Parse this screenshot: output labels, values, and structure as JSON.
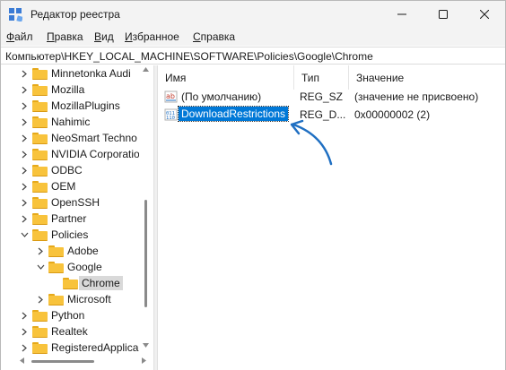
{
  "window": {
    "title": "Редактор реестра"
  },
  "menu": {
    "items": [
      {
        "label": "Файл",
        "accel": "Ф",
        "rest": "айл"
      },
      {
        "label": "Правка",
        "accel": "П",
        "rest": "равка"
      },
      {
        "label": "Вид",
        "accel": "В",
        "rest": "ид"
      },
      {
        "label": "Избранное",
        "accel": "И",
        "rest": "збранное"
      },
      {
        "label": "Справка",
        "accel": "С",
        "rest": "правка"
      }
    ]
  },
  "address": {
    "path": "Компьютер\\HKEY_LOCAL_MACHINE\\SOFTWARE\\Policies\\Google\\Chrome"
  },
  "tree": {
    "items": [
      {
        "label": "Minnetonka Audi",
        "level": 1,
        "expand": "collapsed"
      },
      {
        "label": "Mozilla",
        "level": 1,
        "expand": "collapsed"
      },
      {
        "label": "MozillaPlugins",
        "level": 1,
        "expand": "collapsed"
      },
      {
        "label": "Nahimic",
        "level": 1,
        "expand": "collapsed"
      },
      {
        "label": "NeoSmart Techno",
        "level": 1,
        "expand": "collapsed"
      },
      {
        "label": "NVIDIA Corporatio",
        "level": 1,
        "expand": "collapsed"
      },
      {
        "label": "ODBC",
        "level": 1,
        "expand": "collapsed"
      },
      {
        "label": "OEM",
        "level": 1,
        "expand": "collapsed"
      },
      {
        "label": "OpenSSH",
        "level": 1,
        "expand": "collapsed"
      },
      {
        "label": "Partner",
        "level": 1,
        "expand": "collapsed"
      },
      {
        "label": "Policies",
        "level": 1,
        "expand": "expanded"
      },
      {
        "label": "Adobe",
        "level": 2,
        "expand": "collapsed"
      },
      {
        "label": "Google",
        "level": 2,
        "expand": "expanded"
      },
      {
        "label": "Chrome",
        "level": 3,
        "expand": "none",
        "selected": true
      },
      {
        "label": "Microsoft",
        "level": 2,
        "expand": "collapsed"
      },
      {
        "label": "Python",
        "level": 1,
        "expand": "collapsed"
      },
      {
        "label": "Realtek",
        "level": 1,
        "expand": "collapsed"
      },
      {
        "label": "RegisteredApplica",
        "level": 1,
        "expand": "collapsed"
      }
    ]
  },
  "list": {
    "columns": {
      "name": "Имя",
      "type": "Тип",
      "value": "Значение"
    },
    "rows": [
      {
        "icon": "string-value-icon",
        "name": "(По умолчанию)",
        "type": "REG_SZ",
        "data": "(значение не присвоено)",
        "selected": false
      },
      {
        "icon": "dword-value-icon",
        "name": "DownloadRestrictions",
        "type": "REG_D...",
        "data": "0x00000002 (2)",
        "selected": true
      }
    ]
  },
  "colors": {
    "selection": "#0078d7",
    "folder": "#f8c33c",
    "annotation_arrow": "#1f6fc2"
  }
}
